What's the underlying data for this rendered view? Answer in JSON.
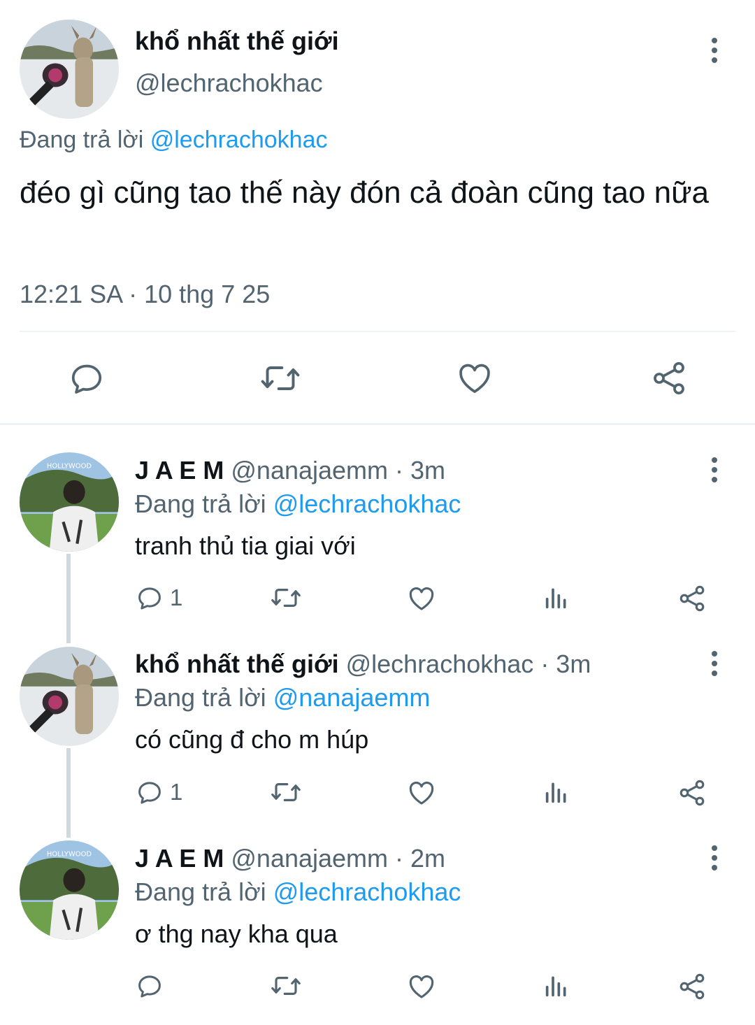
{
  "main_tweet": {
    "display_name": "khổ nhất thế giới",
    "handle": "@lechrachokhac",
    "reply_prefix": "Đang trả lời",
    "reply_to": "@lechrachokhac",
    "text": "đéo gì cũng tao thế này đón cả đoàn cũng tao nữa",
    "timestamp": "12:21 SA · 10 thg 7 25",
    "avatar_icon": "deer-with-microphone-avatar"
  },
  "replies": [
    {
      "display_name": "J A E M",
      "handle": "@nanajaemm",
      "time": "· 3m",
      "reply_prefix": "Đang trả lời",
      "reply_to": "@lechrachokhac",
      "text": "tranh thủ tia giai với",
      "reply_count": "1",
      "avatar_icon": "person-hollywood-avatar"
    },
    {
      "display_name": "khổ nhất thế giới",
      "handle": "@lechrachokhac",
      "time": "· 3m",
      "reply_prefix": "Đang trả lời",
      "reply_to": "@nanajaemm",
      "text": "có cũng đ cho m húp",
      "reply_count": "1",
      "avatar_icon": "deer-with-microphone-avatar"
    },
    {
      "display_name": "J A E M",
      "handle": "@nanajaemm",
      "time": "· 2m",
      "reply_prefix": "Đang trả lời",
      "reply_to": "@lechrachokhac",
      "text": "ơ thg nay kha qua",
      "reply_count": "",
      "avatar_icon": "person-hollywood-avatar"
    }
  ],
  "colors": {
    "text": "#0f1419",
    "muted": "#536471",
    "link": "#1d9bf0",
    "divider": "#eff3f4",
    "thread_line": "#cfd9de"
  }
}
